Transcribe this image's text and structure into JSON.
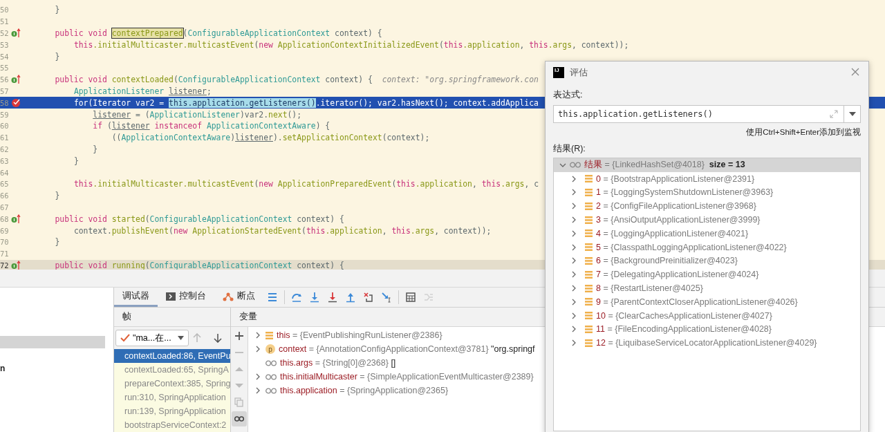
{
  "editor": {
    "lines": [
      {
        "number": "50",
        "executing": false,
        "caret": false,
        "tokens": [
          {
            "kind": "txt",
            "text": "    }"
          }
        ]
      },
      {
        "number": "51",
        "executing": false,
        "caret": false
      },
      {
        "number": "52",
        "executing": false,
        "caret": false,
        "gutter": {
          "kind": "override"
        },
        "tokens": [
          {
            "kind": "kw",
            "text": "    public void "
          },
          {
            "kind": "boxed",
            "text": "contextPrepared"
          },
          {
            "kind": "txt",
            "text": "("
          },
          {
            "kind": "type",
            "text": "ConfigurableApplicationContext"
          },
          {
            "kind": "txt",
            "text": " context) {"
          }
        ]
      },
      {
        "number": "53",
        "executing": false,
        "caret": false,
        "tokens": [
          {
            "kind": "kw",
            "text": "        this"
          },
          {
            "kind": "fn",
            "text": ".initialMulticaster.multicastEvent"
          },
          {
            "kind": "txt",
            "text": "("
          },
          {
            "kind": "kw",
            "text": "new "
          },
          {
            "kind": "fn",
            "text": "ApplicationContextInitializedEvent"
          },
          {
            "kind": "txt",
            "text": "("
          },
          {
            "kind": "kw",
            "text": "this"
          },
          {
            "kind": "fn",
            "text": ".application"
          },
          {
            "kind": "txt",
            "text": ", "
          },
          {
            "kind": "kw",
            "text": "this"
          },
          {
            "kind": "fn",
            "text": ".args"
          },
          {
            "kind": "txt",
            "text": ", context));"
          }
        ]
      },
      {
        "number": "54",
        "executing": false,
        "caret": false,
        "tokens": [
          {
            "kind": "txt",
            "text": "    }"
          }
        ]
      },
      {
        "number": "55",
        "executing": false,
        "caret": false
      },
      {
        "number": "56",
        "executing": false,
        "caret": false,
        "gutter": {
          "kind": "override"
        },
        "tokens": [
          {
            "kind": "kw",
            "text": "    public void "
          },
          {
            "kind": "fn",
            "text": "contextLoaded"
          },
          {
            "kind": "txt",
            "text": "("
          },
          {
            "kind": "type",
            "text": "ConfigurableApplicationContext"
          },
          {
            "kind": "txt",
            "text": " context) {"
          },
          {
            "kind": "hint",
            "text": "  context: \"org.springframework.con"
          }
        ]
      },
      {
        "number": "57",
        "executing": false,
        "caret": false,
        "tokens": [
          {
            "kind": "type",
            "text": "        ApplicationListener "
          },
          {
            "kind": "var",
            "text": "listener"
          },
          {
            "kind": "txt",
            "text": ";"
          }
        ]
      },
      {
        "number": "58",
        "executing": true,
        "caret": false,
        "gutter": {
          "kind": "breakpoint"
        },
        "tokens": [
          {
            "kind": "txt",
            "text": "        for(Iterator var2 = "
          },
          {
            "kind": "match",
            "text": "this.application.getListeners()"
          },
          {
            "kind": "txt",
            "text": ".iterator(); var2.hasNext(); context.addApplica"
          }
        ]
      },
      {
        "number": "59",
        "executing": false,
        "caret": false,
        "tokens": [
          {
            "kind": "var",
            "text": "            listener"
          },
          {
            "kind": "txt",
            "text": " = ("
          },
          {
            "kind": "type",
            "text": "ApplicationListener"
          },
          {
            "kind": "txt",
            "text": ")var2."
          },
          {
            "kind": "fn",
            "text": "next"
          },
          {
            "kind": "txt",
            "text": "();"
          }
        ]
      },
      {
        "number": "60",
        "executing": false,
        "caret": false,
        "tokens": [
          {
            "kind": "kw",
            "text": "            if"
          },
          {
            "kind": "txt",
            "text": " ("
          },
          {
            "kind": "var",
            "text": "listener"
          },
          {
            "kind": "kw",
            "text": " instanceof "
          },
          {
            "kind": "type",
            "text": "ApplicationContextAware"
          },
          {
            "kind": "txt",
            "text": ") {"
          }
        ]
      },
      {
        "number": "61",
        "executing": false,
        "caret": false,
        "tokens": [
          {
            "kind": "txt",
            "text": "                (("
          },
          {
            "kind": "type",
            "text": "ApplicationContextAware"
          },
          {
            "kind": "txt",
            "text": ")"
          },
          {
            "kind": "var",
            "text": "listener"
          },
          {
            "kind": "txt",
            "text": ")."
          },
          {
            "kind": "fn",
            "text": "setApplicationContext"
          },
          {
            "kind": "txt",
            "text": "(context);"
          }
        ]
      },
      {
        "number": "62",
        "executing": false,
        "caret": false,
        "tokens": [
          {
            "kind": "txt",
            "text": "            }"
          }
        ]
      },
      {
        "number": "63",
        "executing": false,
        "caret": false,
        "tokens": [
          {
            "kind": "txt",
            "text": "        }"
          }
        ]
      },
      {
        "number": "64",
        "executing": false,
        "caret": false
      },
      {
        "number": "65",
        "executing": false,
        "caret": false,
        "tokens": [
          {
            "kind": "kw",
            "text": "        this"
          },
          {
            "kind": "fn",
            "text": ".initialMulticaster.multicastEvent"
          },
          {
            "kind": "txt",
            "text": "("
          },
          {
            "kind": "kw",
            "text": "new "
          },
          {
            "kind": "fn",
            "text": "ApplicationPreparedEvent"
          },
          {
            "kind": "txt",
            "text": "("
          },
          {
            "kind": "kw",
            "text": "this"
          },
          {
            "kind": "fn",
            "text": ".application"
          },
          {
            "kind": "txt",
            "text": ", "
          },
          {
            "kind": "kw",
            "text": "this"
          },
          {
            "kind": "fn",
            "text": ".args"
          },
          {
            "kind": "txt",
            "text": ", c"
          }
        ]
      },
      {
        "number": "66",
        "executing": false,
        "caret": false,
        "tokens": [
          {
            "kind": "txt",
            "text": "    }"
          }
        ]
      },
      {
        "number": "67",
        "executing": false,
        "caret": false
      },
      {
        "number": "68",
        "executing": false,
        "caret": false,
        "gutter": {
          "kind": "override"
        },
        "tokens": [
          {
            "kind": "kw",
            "text": "    public void "
          },
          {
            "kind": "fn",
            "text": "started"
          },
          {
            "kind": "txt",
            "text": "("
          },
          {
            "kind": "type",
            "text": "ConfigurableApplicationContext"
          },
          {
            "kind": "txt",
            "text": " context) {"
          }
        ]
      },
      {
        "number": "69",
        "executing": false,
        "caret": false,
        "tokens": [
          {
            "kind": "txt",
            "text": "        context."
          },
          {
            "kind": "fn",
            "text": "publishEvent"
          },
          {
            "kind": "txt",
            "text": "("
          },
          {
            "kind": "kw",
            "text": "new "
          },
          {
            "kind": "fn",
            "text": "ApplicationStartedEvent"
          },
          {
            "kind": "txt",
            "text": "("
          },
          {
            "kind": "kw",
            "text": "this"
          },
          {
            "kind": "fn",
            "text": ".application"
          },
          {
            "kind": "txt",
            "text": ", "
          },
          {
            "kind": "kw",
            "text": "this"
          },
          {
            "kind": "fn",
            "text": ".args"
          },
          {
            "kind": "txt",
            "text": ", context));"
          }
        ]
      },
      {
        "number": "70",
        "executing": false,
        "caret": false,
        "tokens": [
          {
            "kind": "txt",
            "text": "    }"
          }
        ]
      },
      {
        "number": "71",
        "executing": false,
        "caret": false
      },
      {
        "number": "72",
        "executing": false,
        "caret": true,
        "gutter": {
          "kind": "override"
        },
        "tokens": [
          {
            "kind": "kw",
            "text": "    public void "
          },
          {
            "kind": "fn",
            "text": "running"
          },
          {
            "kind": "txt",
            "text": "("
          },
          {
            "kind": "type",
            "text": "ConfigurableApplicationContext"
          },
          {
            "kind": "txt",
            "text": " context) {"
          }
        ]
      }
    ]
  },
  "left_panel": {
    "fragment": "n"
  },
  "debugger": {
    "tabs": [
      {
        "label": "调试器",
        "kind": "plain",
        "selected": true
      },
      {
        "label": "控制台",
        "kind": "console",
        "selected": false
      },
      {
        "label": "断点",
        "kind": "breakpoints",
        "selected": false
      }
    ],
    "toolbar": [
      {
        "kind": "layout",
        "disabled": false
      },
      {
        "kind": "step-over",
        "disabled": false
      },
      {
        "kind": "step-into",
        "disabled": false
      },
      {
        "kind": "force-step-into",
        "disabled": false
      },
      {
        "kind": "step-out",
        "disabled": false
      },
      {
        "kind": "drop-frame",
        "disabled": false
      },
      {
        "kind": "run-to-cursor",
        "disabled": false
      },
      {
        "kind": "evaluate",
        "disabled": false
      },
      {
        "kind": "trace",
        "disabled": true
      }
    ],
    "frames_header": "帧",
    "thread": "\"ma...在...",
    "frames": [
      {
        "label": "contextLoaded:86, EventPu",
        "selected": true
      },
      {
        "label": "contextLoaded:65, SpringA",
        "selected": false
      },
      {
        "label": "prepareContext:385, Spring",
        "selected": false
      },
      {
        "label": "run:310, SpringApplication",
        "selected": false
      },
      {
        "label": "run:139, SpringApplication",
        "selected": false
      },
      {
        "label": "bootstrapServiceContext:2",
        "selected": false
      }
    ],
    "variables_header": "变量",
    "side_tools": [
      {
        "kind": "add",
        "disabled": false,
        "selected": false
      },
      {
        "kind": "remove",
        "disabled": true,
        "selected": false
      },
      {
        "kind": "up",
        "disabled": true,
        "selected": false
      },
      {
        "kind": "down",
        "disabled": true,
        "selected": false
      },
      {
        "kind": "copy",
        "disabled": true,
        "selected": false
      },
      {
        "kind": "watches",
        "disabled": false,
        "selected": true
      }
    ],
    "variables": [
      {
        "kind": "field",
        "expandable": true,
        "name": "this",
        "value": "= {EventPublishingRunListener@2386}"
      },
      {
        "kind": "param",
        "badge": "p",
        "expandable": true,
        "name": "context",
        "value": "= {AnnotationConfigApplicationContext@3781}",
        "extra": "\"org.springf"
      },
      {
        "kind": "watch",
        "expandable": false,
        "name": "this.args",
        "value": "= {String[0]@2368}",
        "extra": "[]"
      },
      {
        "kind": "watch",
        "expandable": true,
        "name": "this.initialMulticaster",
        "value": "= {SimpleApplicationEventMulticaster@2389}"
      },
      {
        "kind": "watch",
        "expandable": true,
        "name": "this.application",
        "value": "= {SpringApplication@2365}"
      }
    ]
  },
  "dialog": {
    "logo": "IJ",
    "title": "评估",
    "expression_label": "表达式:",
    "expression": "this.application.getListeners()",
    "hint": "使用Ctrl+Shift+Enter添加到监视",
    "result_label": "结果(R):",
    "result": {
      "name": "结果",
      "value": "= {LinkedHashSet@4018}",
      "extra": "size = 13",
      "expanded": true,
      "selected": true,
      "children": [
        {
          "name": "0",
          "value": "= {BootstrapApplicationListener@2391}",
          "expanded": false
        },
        {
          "name": "1",
          "value": "= {LoggingSystemShutdownListener@3963}",
          "expanded": false
        },
        {
          "name": "2",
          "value": "= {ConfigFileApplicationListener@3968}",
          "expanded": false
        },
        {
          "name": "3",
          "value": "= {AnsiOutputApplicationListener@3999}",
          "expanded": false
        },
        {
          "name": "4",
          "value": "= {LoggingApplicationListener@4021}",
          "expanded": false
        },
        {
          "name": "5",
          "value": "= {ClasspathLoggingApplicationListener@4022}",
          "expanded": false
        },
        {
          "name": "6",
          "value": "= {BackgroundPreinitializer@4023}",
          "expanded": false
        },
        {
          "name": "7",
          "value": "= {DelegatingApplicationListener@4024}",
          "expanded": false
        },
        {
          "name": "8",
          "value": "= {RestartListener@4025}",
          "expanded": false
        },
        {
          "name": "9",
          "value": "= {ParentContextCloserApplicationListener@4026}",
          "expanded": false
        },
        {
          "name": "10",
          "value": "= {ClearCachesApplicationListener@4027}",
          "expanded": false
        },
        {
          "name": "11",
          "value": "= {FileEncodingApplicationListener@4028}",
          "expanded": false
        },
        {
          "name": "12",
          "value": "= {LiquibaseServiceLocatorApplicationListener@4029}",
          "expanded": false
        }
      ]
    }
  }
}
